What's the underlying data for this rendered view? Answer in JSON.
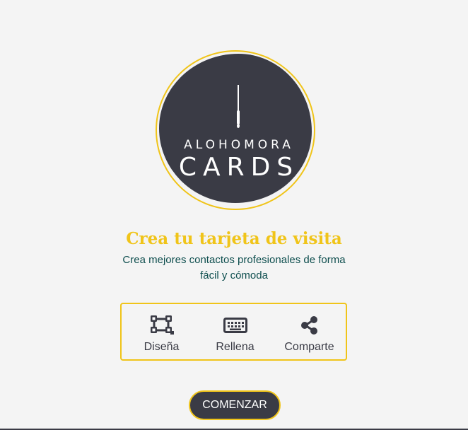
{
  "brand": {
    "logo_line1": "ALOHOMORA",
    "logo_line2": "CARDS"
  },
  "hero": {
    "title": "Crea tu tarjeta de visita",
    "subtitle": "Crea mejores contactos profesionales de forma fácil y cómoda"
  },
  "features": [
    {
      "icon": "crop-design-icon",
      "label": "Diseña"
    },
    {
      "icon": "keyboard-icon",
      "label": "Rellena"
    },
    {
      "icon": "share-icon",
      "label": "Comparte"
    }
  ],
  "cta": {
    "label": "COMENZAR"
  },
  "colors": {
    "accent": "#f0c419",
    "dark": "#3a3b45",
    "teal": "#0f4f4f",
    "background": "#f4f4f4"
  }
}
